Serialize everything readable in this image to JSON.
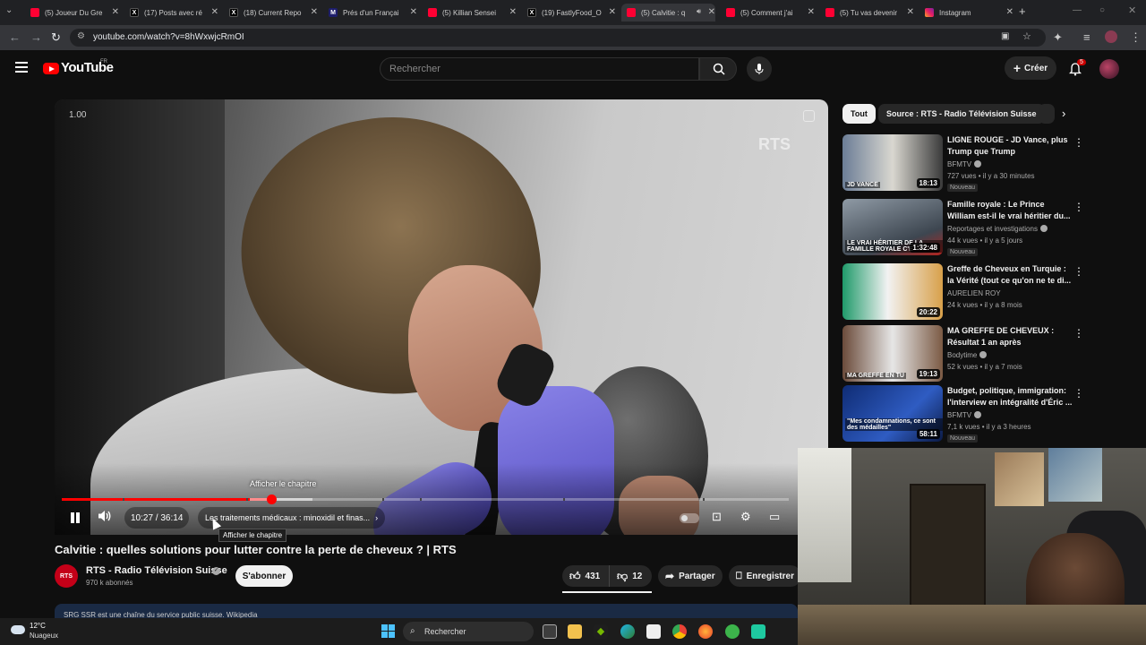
{
  "browser": {
    "tabs": [
      {
        "label": "(5) Joueur Du Gre",
        "favicon": "youtube-favicon"
      },
      {
        "label": "(17) Posts avec ré",
        "favicon": "x-favicon"
      },
      {
        "label": "(18) Current Repo",
        "favicon": "x-favicon"
      },
      {
        "label": "Prés d'un Françai",
        "favicon": "mx-favicon"
      },
      {
        "label": "(5) Killian Sensei",
        "favicon": "youtube-favicon"
      },
      {
        "label": "(19) FastlyFood_O",
        "favicon": "x-favicon"
      },
      {
        "label": "(5) Calvitie : q",
        "favicon": "youtube-favicon",
        "active": true
      },
      {
        "label": "(5) Comment j'ai",
        "favicon": "youtube-favicon"
      },
      {
        "label": "(5) Tu vas devenir",
        "favicon": "youtube-favicon"
      },
      {
        "label": "Instagram",
        "favicon": "instagram-favicon"
      }
    ],
    "fav_letters": {
      "x": "X",
      "mx": "M"
    },
    "url": "youtube.com/watch?v=8hWxwjcRmOI"
  },
  "youtube": {
    "logo_text": "YouTube",
    "region": "FR",
    "search_placeholder": "Rechercher",
    "create_label": "Créer",
    "notification_count": "5"
  },
  "player": {
    "playback_speed": "1.00",
    "watermark": "RTS",
    "chapter_tooltip": "Afficher le chapitre",
    "time": "10:27 / 36:14",
    "chapter_title": "Les traitements médicaux : minoxidil et finas...",
    "progress_fraction": 0.288
  },
  "video": {
    "title": "Calvitie : quelles solutions pour lutter contre la perte de cheveux ? | RTS",
    "channel": "RTS - Radio Télévision Suisse",
    "channel_avatar_text": "RTS",
    "subscribers": "970 k abonnés",
    "subscribe_label": "S'abonner",
    "likes": "431",
    "dislikes": "12",
    "share_label": "Partager",
    "save_label": "Enregistrer",
    "description_snippet": "SRG SSR est une chaîne du service public suisse. Wikipedia"
  },
  "sidebar": {
    "chips": [
      "Tout",
      "Source : RTS - Radio Télévision Suisse"
    ],
    "recommendations": [
      {
        "title": "LIGNE ROUGE - JD Vance, plus Trump que Trump",
        "channel": "BFMTV",
        "verified": true,
        "meta": "727 vues • il y a 30 minutes",
        "badge": "Nouveau",
        "duration": "18:13",
        "thumb_caption": "JD VANCE"
      },
      {
        "title": "Famille royale : Le Prince William est-il le vrai héritier du...",
        "channel": "Reportages et investigations",
        "verified": true,
        "meta": "44 k vues • il y a 5 jours",
        "badge": "Nouveau",
        "duration": "1:32:48",
        "thumb_caption": "LE VRAI HÉRITIER DE LA FAMILLE ROYALE C'E"
      },
      {
        "title": "Greffe de Cheveux en Turquie : la Vérité (tout ce qu'on ne te di...",
        "channel": "AURELIEN ROY",
        "verified": false,
        "meta": "24 k vues • il y a 8 mois",
        "badge": "",
        "duration": "20:22",
        "thumb_caption": ""
      },
      {
        "title": "MA GREFFE DE CHEVEUX : Résultat 1 an après",
        "channel": "Bodytime",
        "verified": true,
        "meta": "52 k vues • il y a 7 mois",
        "badge": "",
        "duration": "19:13",
        "thumb_caption": "MA GREFFE EN TU"
      },
      {
        "title": "Budget, politique, immigration: l'interview en intégralité d'Éric ...",
        "channel": "BFMTV",
        "verified": true,
        "meta": "7,1 k vues • il y a 3 heures",
        "badge": "Nouveau",
        "duration": "58:11",
        "thumb_caption": "\"Mes condamnations, ce sont des médailles\""
      }
    ]
  },
  "taskbar": {
    "temperature": "12°C",
    "weather": "Nuageux",
    "search_label": "Rechercher"
  },
  "colors": {
    "accent": "#ff0000",
    "background": "#0f0f0f",
    "surface": "#272727"
  }
}
